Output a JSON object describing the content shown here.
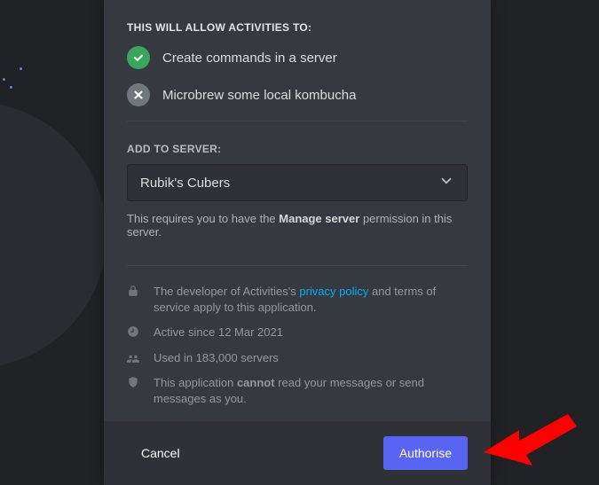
{
  "permissions": {
    "title": "THIS WILL ALLOW ACTIVITIES TO:",
    "items": [
      {
        "label": "Create commands in a server",
        "allowed": true
      },
      {
        "label": "Microbrew some local kombucha",
        "allowed": false
      }
    ]
  },
  "server": {
    "title": "ADD TO SERVER:",
    "selected": "Rubik's Cubers",
    "hint_prefix": "This requires you to have the ",
    "hint_bold": "Manage server",
    "hint_suffix": " permission in this server."
  },
  "info": {
    "policy_prefix": "The developer of Activities's ",
    "policy_link": "privacy policy",
    "policy_suffix": " and terms of service apply to this application.",
    "active": "Active since 12 Mar 2021",
    "servers": "Used in 183,000 servers",
    "cannot_prefix": "This application ",
    "cannot_bold": "cannot",
    "cannot_suffix": " read your messages or send messages as you."
  },
  "buttons": {
    "cancel": "Cancel",
    "authorise": "Authorise"
  }
}
